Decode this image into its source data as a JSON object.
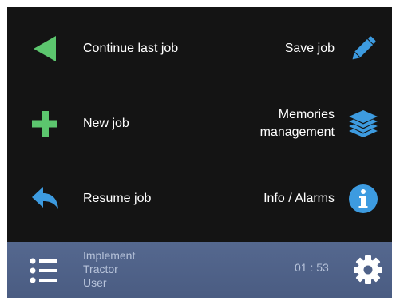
{
  "menu": {
    "continue_last_job": "Continue last job",
    "save_job": "Save job",
    "new_job": "New job",
    "memories_management_line1": "Memories",
    "memories_management_line2": "management",
    "resume_job": "Resume job",
    "info_alarms": "Info / Alarms"
  },
  "status": {
    "implement": "Implement",
    "tractor": "Tractor",
    "user": "User",
    "time": "01 : 53"
  },
  "colors": {
    "background": "#141414",
    "green_icon": "#5cc66e",
    "blue_icon": "#3d9be0",
    "footer": "#51648b",
    "footer_text": "#b7c3da"
  },
  "icons": {
    "continue_last_job": "play-left-triangle-icon",
    "save_job": "pencil-icon",
    "new_job": "plus-icon",
    "memories_management": "layers-stack-icon",
    "resume_job": "undo-arrow-icon",
    "info_alarms": "info-icon",
    "footer_menu": "list-icon",
    "settings": "gear-icon"
  }
}
